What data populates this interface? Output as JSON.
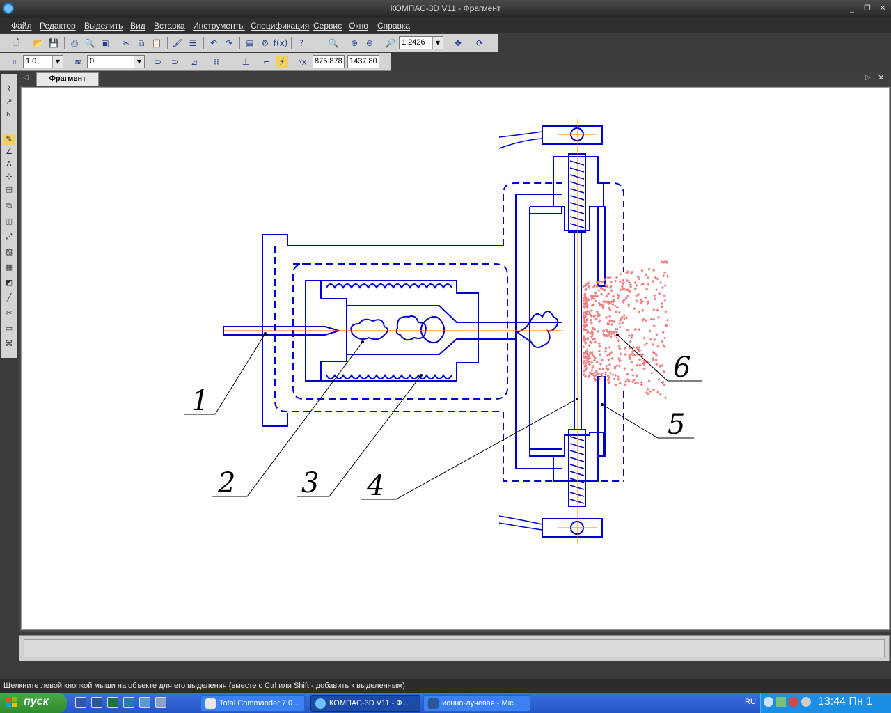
{
  "window": {
    "title": "КОМПАС-3D V11 - Фрагмент"
  },
  "menu": [
    "Файл",
    "Редактор",
    "Выделить",
    "Вид",
    "Вставка",
    "Инструменты",
    "Спецификация",
    "Сервис",
    "Окно",
    "Справка"
  ],
  "toolbar1": {
    "zoom_value": "1.2426"
  },
  "toolbar2": {
    "step_value": "1.0",
    "layer_value": "0",
    "coord_x": "875.878",
    "coord_y": "1437.80"
  },
  "document": {
    "tab_label": "Фрагмент"
  },
  "drawing": {
    "callouts": [
      "1",
      "2",
      "3",
      "4",
      "5",
      "6"
    ]
  },
  "status": {
    "hint": "Щелкните левой кнопкой мыши на объекте для его выделения (вместе с Ctrl или Shift - добавить к выделенным)"
  },
  "taskbar": {
    "start_label": "пуск",
    "tasks": [
      "Total Commander 7.0...",
      "КОМПАС-3D V11 - Ф...",
      "ионно-лучевая - Mic..."
    ],
    "lang": "RU",
    "clock": "13:44 Пн 1"
  },
  "colors": {
    "drawing_line": "#0000cc",
    "axis_line": "#ff8000",
    "particles": "#f08080"
  }
}
